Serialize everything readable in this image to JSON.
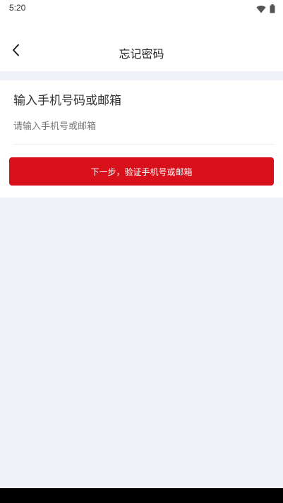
{
  "status_bar": {
    "time": "5:20",
    "icons": [
      "wifi-icon",
      "battery-icon"
    ]
  },
  "header": {
    "back_icon": "chevron-left-icon",
    "title": "忘记密码"
  },
  "form": {
    "heading": "输入手机号码或邮箱",
    "account_input": {
      "value": "",
      "placeholder": "请输入手机号或邮箱"
    },
    "next_button_label": "下一步，验证手机号或邮箱"
  },
  "colors": {
    "accent": "#d7101c",
    "page_background": "#f1f2f7",
    "surface": "#ffffff"
  }
}
